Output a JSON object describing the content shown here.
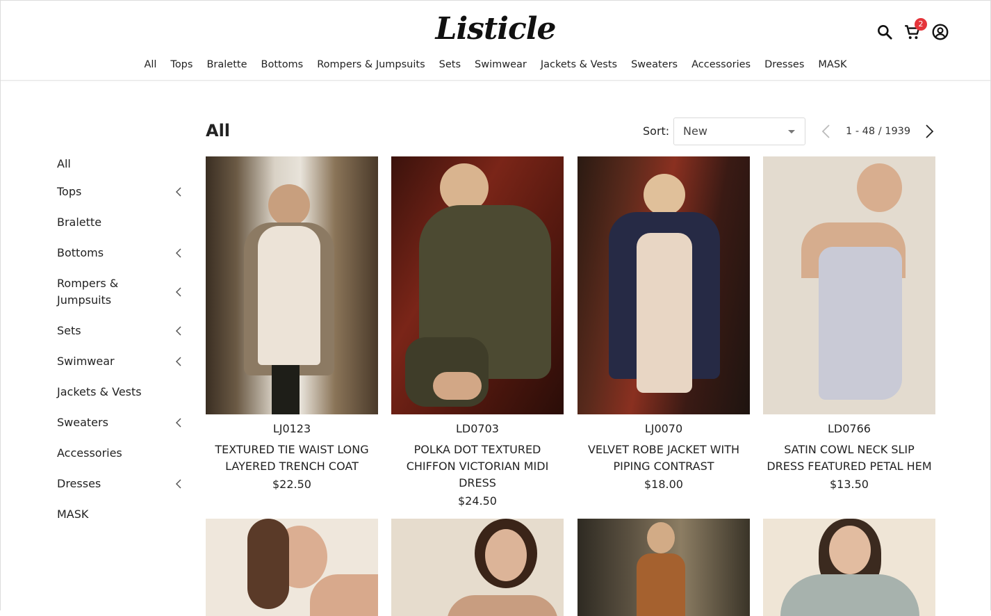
{
  "header": {
    "logo": "Listicle",
    "cart_count": "2",
    "nav": [
      "All",
      "Tops",
      "Bralette",
      "Bottoms",
      "Rompers & Jumpsuits",
      "Sets",
      "Swimwear",
      "Jackets & Vests",
      "Sweaters",
      "Accessories",
      "Dresses",
      "MASK"
    ]
  },
  "icons": {
    "search": "search-icon",
    "cart": "cart-icon",
    "account": "account-icon",
    "chevron": "chevron-left-icon"
  },
  "sidebar": {
    "items": [
      {
        "label": "All",
        "expandable": false
      },
      {
        "label": "Tops",
        "expandable": true
      },
      {
        "label": "Bralette",
        "expandable": false
      },
      {
        "label": "Bottoms",
        "expandable": true
      },
      {
        "label": "Rompers & Jumpsuits",
        "expandable": true
      },
      {
        "label": "Sets",
        "expandable": true
      },
      {
        "label": "Swimwear",
        "expandable": true
      },
      {
        "label": "Jackets & Vests",
        "expandable": false
      },
      {
        "label": "Sweaters",
        "expandable": true
      },
      {
        "label": "Accessories",
        "expandable": false
      },
      {
        "label": "Dresses",
        "expandable": true
      },
      {
        "label": "MASK",
        "expandable": false
      }
    ]
  },
  "main": {
    "title": "All",
    "sort_label": "Sort:",
    "sort_value": "New",
    "pagination": "1 - 48 / 1939"
  },
  "products": [
    {
      "sku": "LJ0123",
      "name": "TEXTURED TIE WAIST LONG LAYERED TRENCH COAT",
      "price": "$22.50"
    },
    {
      "sku": "LD0703",
      "name": "POLKA DOT TEXTURED CHIFFON VICTORIAN MIDI DRESS",
      "price": "$24.50"
    },
    {
      "sku": "LJ0070",
      "name": "VELVET ROBE JACKET WITH PIPING CONTRAST",
      "price": "$18.00"
    },
    {
      "sku": "LD0766",
      "name": "SATIN COWL NECK SLIP DRESS FEATURED PETAL HEM",
      "price": "$13.50"
    }
  ],
  "colors": {
    "badge": "#e5343a",
    "text": "#222222",
    "border": "#dadada"
  }
}
